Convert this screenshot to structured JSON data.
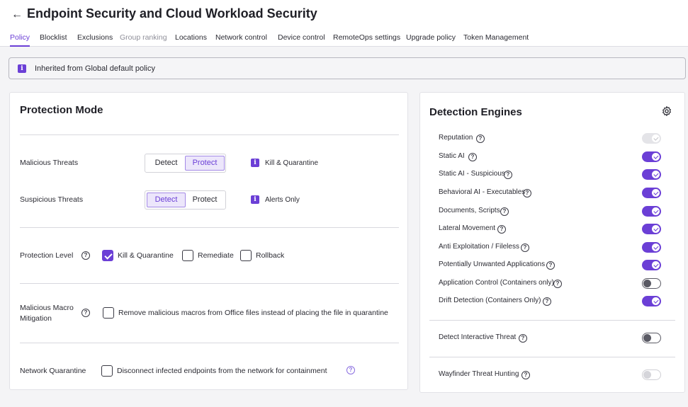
{
  "header": {
    "title": "Endpoint Security and Cloud Workload Security",
    "back_icon": "arrow-left-icon"
  },
  "tabs": [
    {
      "label": "Policy",
      "state": "active"
    },
    {
      "label": "Blocklist",
      "state": "normal"
    },
    {
      "label": "Exclusions",
      "state": "normal"
    },
    {
      "label": "Group ranking",
      "state": "disabled"
    },
    {
      "label": "Locations",
      "state": "normal"
    },
    {
      "label": "Network control",
      "state": "normal"
    },
    {
      "label": "Device control",
      "state": "normal"
    },
    {
      "label": "RemoteOps settings",
      "state": "normal"
    },
    {
      "label": "Upgrade policy",
      "state": "normal"
    },
    {
      "label": "Token Management",
      "state": "normal"
    }
  ],
  "banner": {
    "icon": "info-icon",
    "text": "Inherited from Global default policy"
  },
  "protection_mode": {
    "title": "Protection Mode",
    "malicious": {
      "label": "Malicious Threats",
      "options": [
        "Detect",
        "Protect"
      ],
      "selected": "Protect",
      "note": "Kill & Quarantine"
    },
    "suspicious": {
      "label": "Suspicious Threats",
      "options": [
        "Detect",
        "Protect"
      ],
      "selected": "Detect",
      "note": "Alerts Only"
    },
    "protection_level": {
      "label": "Protection Level",
      "options": [
        {
          "label": "Kill & Quarantine",
          "checked": true
        },
        {
          "label": "Remediate",
          "checked": false
        },
        {
          "label": "Rollback",
          "checked": false
        }
      ]
    },
    "macro": {
      "label_line1": "Malicious Macro",
      "label_line2": "Mitigation",
      "option": "Remove malicious macros from Office files instead of placing the file in quarantine",
      "checked": false
    },
    "network_quarantine": {
      "label": "Network Quarantine",
      "option": "Disconnect infected endpoints from the network for containment",
      "checked": false
    }
  },
  "detection_engines": {
    "title": "Detection Engines",
    "settings_icon": "gear-icon",
    "engines": [
      {
        "label": "Reputation",
        "state": "disabled-on"
      },
      {
        "label": "Static AI",
        "state": "on"
      },
      {
        "label": "Static AI - Suspicious",
        "state": "on"
      },
      {
        "label": "Behavioral AI - Executables",
        "state": "on"
      },
      {
        "label": "Documents, Scripts",
        "state": "on"
      },
      {
        "label": "Lateral Movement",
        "state": "on"
      },
      {
        "label": "Anti Exploitation / Fileless",
        "state": "on"
      },
      {
        "label": "Potentially Unwanted Applications",
        "state": "on"
      },
      {
        "label": "Application Control (Containers only)",
        "state": "off"
      },
      {
        "label": "Drift Detection (Containers Only)",
        "state": "on"
      }
    ],
    "interactive": {
      "label": "Detect Interactive Threat",
      "state": "off"
    },
    "wayfinder": {
      "label": "Wayfinder Threat Hunting",
      "state": "disabled-off"
    }
  }
}
